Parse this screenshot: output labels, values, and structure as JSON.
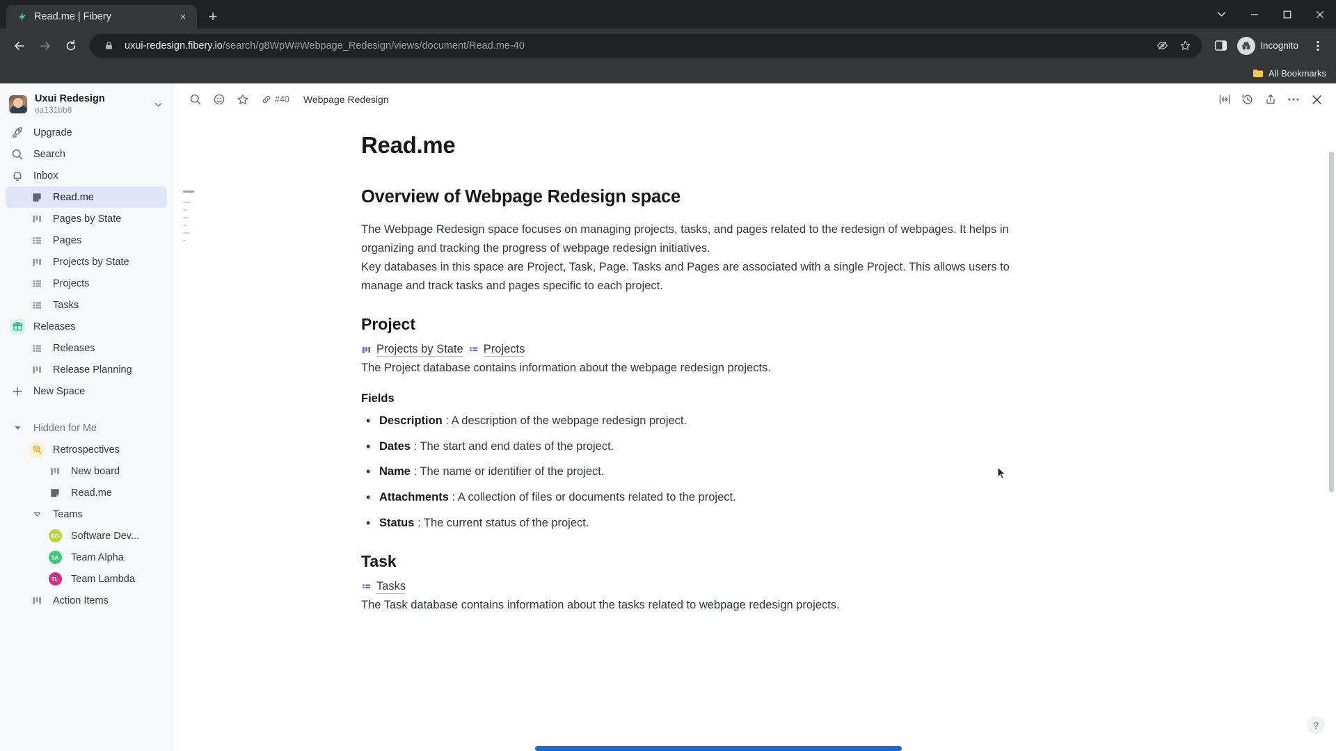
{
  "browser": {
    "tab": {
      "title": "Read.me | Fibery",
      "favicon": "fibery-logo-icon",
      "close": "×"
    },
    "new_tab_label": "+",
    "window_controls": {
      "minimize_extra": "⌄",
      "minimize": "—",
      "maximize": "▢",
      "close": "✕"
    },
    "nav": {
      "back": "←",
      "forward": "→",
      "reload": "⟳"
    },
    "omnibox": {
      "lock_icon": "lock-icon",
      "url_host": "uxui-redesign.fibery.io",
      "url_path": "/search/g8WpW#Webpage_Redesign/views/document/Read.me-40",
      "url_full": "uxui-redesign.fibery.io/search/g8WpW#Webpage_Redesign/views/document/Read.me-40",
      "tracking_icon": "eye-slash-icon",
      "bookmark_icon": "star-icon"
    },
    "side_panel_icon": "side-panel-icon",
    "profile": {
      "label": "Incognito",
      "icon": "incognito-icon"
    },
    "menu_icon": "kebab-menu-icon",
    "bookmarks_bar": {
      "folder_icon": "folder-icon",
      "label": "All Bookmarks"
    }
  },
  "sidebar": {
    "workspace": {
      "name": "Uxui Redesign",
      "id": "ea131bb8",
      "caret": "⌄",
      "avatar": "user-avatar"
    },
    "top_items": [
      {
        "label": "Upgrade",
        "icon": "rocket-icon"
      },
      {
        "label": "Search",
        "icon": "search-icon"
      },
      {
        "label": "Inbox",
        "icon": "bell-icon"
      }
    ],
    "space_items": [
      {
        "label": "Read.me",
        "icon": "document-icon",
        "selected": true
      },
      {
        "label": "Pages by State",
        "icon": "board-icon",
        "selected": false
      },
      {
        "label": "Pages",
        "icon": "grid-icon",
        "selected": false
      },
      {
        "label": "Projects by State",
        "icon": "board-icon",
        "selected": false
      },
      {
        "label": "Projects",
        "icon": "grid-icon",
        "selected": false
      },
      {
        "label": "Tasks",
        "icon": "grid-icon",
        "selected": false
      }
    ],
    "releases_space": {
      "label": "Releases",
      "icon": "gift-icon"
    },
    "releases_items": [
      {
        "label": "Releases",
        "icon": "grid-icon"
      },
      {
        "label": "Release Planning",
        "icon": "board-icon"
      }
    ],
    "new_space": {
      "label": "New Space",
      "icon": "plus-icon"
    },
    "hidden_section": {
      "label": "Hidden for Me",
      "caret": "▼"
    },
    "retrospectives": {
      "label": "Retrospectives",
      "icon": "retro-icon"
    },
    "retro_items": [
      {
        "label": "New board",
        "icon": "board-icon"
      },
      {
        "label": "Read.me",
        "icon": "document-icon"
      }
    ],
    "teams": {
      "label": "Teams",
      "caret": "▽"
    },
    "team_items": [
      {
        "label": "Software Dev...",
        "initials": "SD",
        "color": "#bdd63f"
      },
      {
        "label": "Team Alpha",
        "initials": "TA",
        "color": "#3cc87a"
      },
      {
        "label": "Team Lambda",
        "initials": "TL",
        "color": "#cc2f86"
      }
    ],
    "action_items": {
      "label": "Action Items",
      "icon": "board-icon"
    }
  },
  "doc_toolbar": {
    "search_icon": "search-icon",
    "emoji_icon": "emoji-icon",
    "star_icon": "star-icon",
    "link_icon": "link-icon",
    "entity_id": "#40",
    "breadcrumb": "Webpage Redesign",
    "width_icon": "full-width-icon",
    "history_icon": "history-icon",
    "share_icon": "share-icon",
    "more_icon": "more-horizontal-icon",
    "close_icon": "close-icon"
  },
  "document": {
    "title": "Read.me",
    "overview_heading": "Overview of Webpage Redesign space",
    "overview_p1": "The Webpage Redesign space focuses on managing projects, tasks, and pages related to the redesign of webpages. It helps in organizing and tracking the progress of webpage redesign initiatives.",
    "overview_p2": "Key databases in this space are Project, Task, Page. Tasks and Pages are associated with a single Project. This allows users to manage and track tasks and pages specific to each project.",
    "project": {
      "heading": "Project",
      "links": [
        {
          "label": "Projects by State",
          "icon": "board-icon"
        },
        {
          "label": "Projects",
          "icon": "grid-icon"
        }
      ],
      "description": "The Project database contains information about the webpage redesign projects.",
      "fields_heading": "Fields",
      "fields": [
        {
          "name": "Description",
          "sep": " : ",
          "desc": "A description of the webpage redesign project."
        },
        {
          "name": "Dates",
          "sep": " : ",
          "desc": "The start and end dates of the project."
        },
        {
          "name": "Name",
          "sep": " : ",
          "desc": "The name or identifier of the project."
        },
        {
          "name": "Attachments",
          "sep": " : ",
          "desc": "A collection of files or documents related to the project."
        },
        {
          "name": "Status",
          "sep": " : ",
          "desc": "The current status of the project."
        }
      ]
    },
    "task": {
      "heading": "Task",
      "links": [
        {
          "label": "Tasks",
          "icon": "grid-icon"
        }
      ],
      "description": "The Task database contains information about the tasks related to webpage redesign projects."
    }
  },
  "help_button": "?",
  "colors": {
    "accent_blue": "#1669d6",
    "selection_bg": "#dfe6fa",
    "link_icon_blue": "#5b6ee0",
    "chrome_dark": "#35363a",
    "chrome_darker": "#202124"
  }
}
